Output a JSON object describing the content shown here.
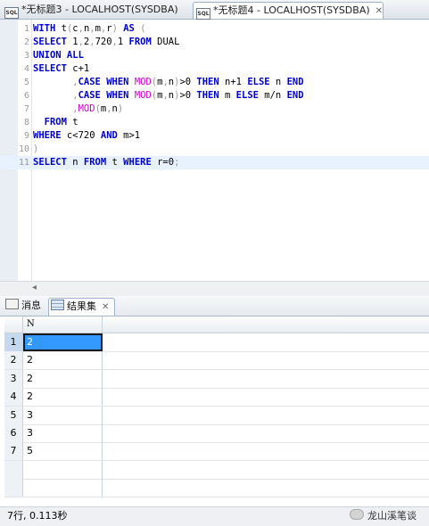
{
  "editor_tabs": [
    {
      "label": "*无标题3 - LOCALHOST(SYSDBA)"
    },
    {
      "label": "*无标题4 - LOCALHOST(SYSDBA)"
    }
  ],
  "tab_close_glyph": "✕",
  "code_lines": [
    {
      "n": "1",
      "segs": [
        [
          "k",
          "WITH"
        ],
        [
          "t",
          " t"
        ],
        [
          "p",
          "("
        ],
        [
          "t",
          "c"
        ],
        [
          "p",
          ","
        ],
        [
          "t",
          "n"
        ],
        [
          "p",
          ","
        ],
        [
          "t",
          "m"
        ],
        [
          "p",
          ","
        ],
        [
          "t",
          "r"
        ],
        [
          "p",
          ")"
        ],
        [
          "t",
          " "
        ],
        [
          "k",
          "AS"
        ],
        [
          "t",
          " "
        ],
        [
          "p",
          "("
        ]
      ]
    },
    {
      "n": "2",
      "segs": [
        [
          "k",
          "SELECT"
        ],
        [
          "t",
          " 1"
        ],
        [
          "p",
          ","
        ],
        [
          "t",
          "2"
        ],
        [
          "p",
          ","
        ],
        [
          "t",
          "720"
        ],
        [
          "p",
          ","
        ],
        [
          "t",
          "1 "
        ],
        [
          "k",
          "FROM"
        ],
        [
          "t",
          " DUAL"
        ]
      ]
    },
    {
      "n": "3",
      "segs": [
        [
          "k",
          "UNION ALL"
        ]
      ]
    },
    {
      "n": "4",
      "segs": [
        [
          "k",
          "SELECT"
        ],
        [
          "t",
          " c+1"
        ]
      ]
    },
    {
      "n": "5",
      "segs": [
        [
          "t",
          "       "
        ],
        [
          "p",
          ","
        ],
        [
          "k",
          "CASE WHEN"
        ],
        [
          "t",
          " "
        ],
        [
          "f",
          "MOD"
        ],
        [
          "p",
          "("
        ],
        [
          "t",
          "m"
        ],
        [
          "p",
          ","
        ],
        [
          "t",
          "n"
        ],
        [
          "p",
          ")"
        ],
        [
          "t",
          ">0 "
        ],
        [
          "k",
          "THEN"
        ],
        [
          "t",
          " n+1 "
        ],
        [
          "k",
          "ELSE"
        ],
        [
          "t",
          " n "
        ],
        [
          "k",
          "END"
        ]
      ]
    },
    {
      "n": "6",
      "segs": [
        [
          "t",
          "       "
        ],
        [
          "p",
          ","
        ],
        [
          "k",
          "CASE WHEN"
        ],
        [
          "t",
          " "
        ],
        [
          "f",
          "MOD"
        ],
        [
          "p",
          "("
        ],
        [
          "t",
          "m"
        ],
        [
          "p",
          ","
        ],
        [
          "t",
          "n"
        ],
        [
          "p",
          ")"
        ],
        [
          "t",
          ">0 "
        ],
        [
          "k",
          "THEN"
        ],
        [
          "t",
          " m "
        ],
        [
          "k",
          "ELSE"
        ],
        [
          "t",
          " m/n "
        ],
        [
          "k",
          "END"
        ]
      ]
    },
    {
      "n": "7",
      "segs": [
        [
          "t",
          "       "
        ],
        [
          "p",
          ","
        ],
        [
          "f",
          "MOD"
        ],
        [
          "p",
          "("
        ],
        [
          "t",
          "m"
        ],
        [
          "p",
          ","
        ],
        [
          "t",
          "n"
        ],
        [
          "p",
          ")"
        ]
      ]
    },
    {
      "n": "8",
      "segs": [
        [
          "t",
          "  "
        ],
        [
          "k",
          "FROM"
        ],
        [
          "t",
          " t"
        ]
      ]
    },
    {
      "n": "9",
      "segs": [
        [
          "k",
          "WHERE"
        ],
        [
          "t",
          " c<720 "
        ],
        [
          "k",
          "AND"
        ],
        [
          "t",
          " m>1"
        ]
      ]
    },
    {
      "n": "10",
      "segs": [
        [
          "p",
          ")"
        ]
      ]
    },
    {
      "n": "11",
      "segs": [
        [
          "k",
          "SELECT"
        ],
        [
          "t",
          " n "
        ],
        [
          "k",
          "FROM"
        ],
        [
          "t",
          " t "
        ],
        [
          "k",
          "WHERE"
        ],
        [
          "t",
          " r=0"
        ],
        [
          "p",
          ";"
        ]
      ]
    }
  ],
  "current_line": "11",
  "scroll_left_glyph": "◂",
  "result_tabs": {
    "messages": "消息",
    "results": "结果集"
  },
  "grid": {
    "column": "N",
    "rows": [
      {
        "num": "1",
        "value": "2"
      },
      {
        "num": "2",
        "value": "2"
      },
      {
        "num": "3",
        "value": "2"
      },
      {
        "num": "4",
        "value": "2"
      },
      {
        "num": "5",
        "value": "3"
      },
      {
        "num": "6",
        "value": "3"
      },
      {
        "num": "7",
        "value": "5"
      }
    ],
    "selected_row": "1"
  },
  "status": {
    "text": "7行, 0.113秒"
  },
  "watermark": {
    "text": "龙山溪笔谈"
  },
  "colors": {
    "keyword": "#0000cc",
    "function": "#cc00cc",
    "selected_cell": "#3399ff"
  }
}
